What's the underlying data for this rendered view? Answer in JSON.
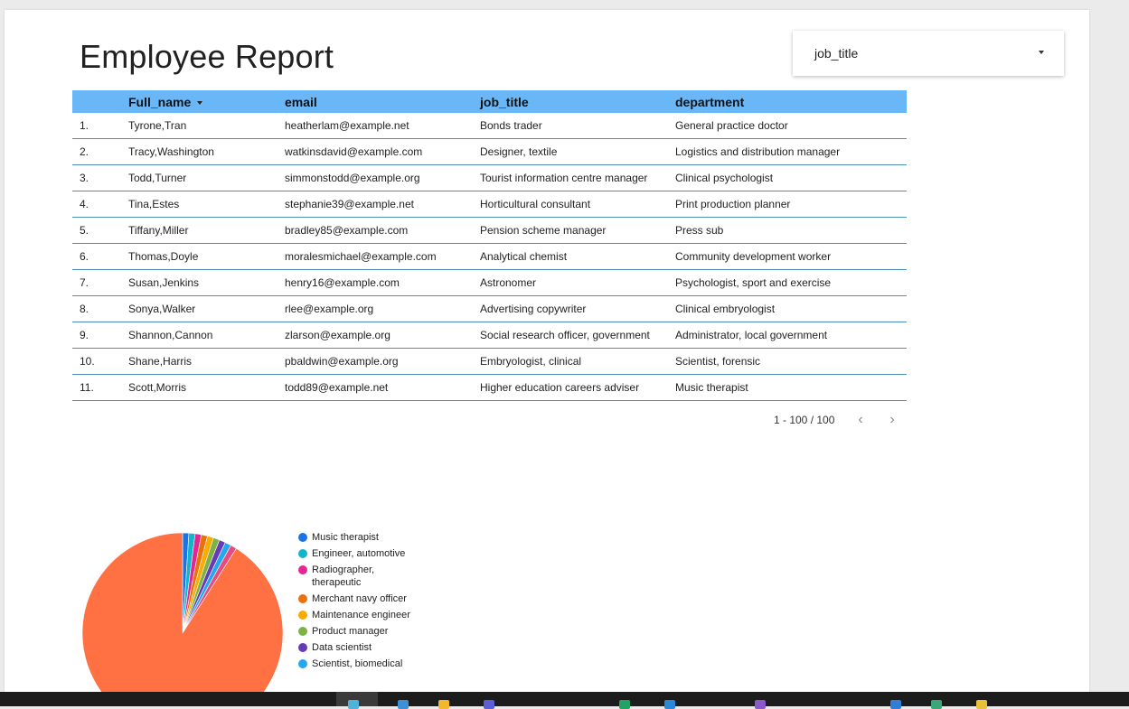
{
  "report": {
    "title": "Employee Report"
  },
  "filter": {
    "label": "job_title"
  },
  "table": {
    "headers": [
      "",
      "Full_name",
      "email",
      "job_title",
      "department"
    ],
    "rows": [
      [
        "1.",
        "Tyrone,Tran",
        "heatherlam@example.net",
        "Bonds trader",
        "General practice doctor"
      ],
      [
        "2.",
        "Tracy,Washington",
        "watkinsdavid@example.com",
        "Designer, textile",
        "Logistics and distribution manager"
      ],
      [
        "3.",
        "Todd,Turner",
        "simmonstodd@example.org",
        "Tourist information centre manager",
        "Clinical psychologist"
      ],
      [
        "4.",
        "Tina,Estes",
        "stephanie39@example.net",
        "Horticultural consultant",
        "Print production planner"
      ],
      [
        "5.",
        "Tiffany,Miller",
        "bradley85@example.com",
        "Pension scheme manager",
        "Press sub"
      ],
      [
        "6.",
        "Thomas,Doyle",
        "moralesmichael@example.com",
        "Analytical chemist",
        "Community development worker"
      ],
      [
        "7.",
        "Susan,Jenkins",
        "henry16@example.com",
        "Astronomer",
        "Psychologist, sport and exercise"
      ],
      [
        "8.",
        "Sonya,Walker",
        "rlee@example.org",
        "Advertising copywriter",
        "Clinical embryologist"
      ],
      [
        "9.",
        "Shannon,Cannon",
        "zlarson@example.org",
        "Social research officer, government",
        "Administrator, local government"
      ],
      [
        "10.",
        "Shane,Harris",
        "pbaldwin@example.org",
        "Embryologist, clinical",
        "Scientist, forensic"
      ],
      [
        "11.",
        "Scott,Morris",
        "todd89@example.net",
        "Higher education careers adviser",
        "Music therapist"
      ]
    ]
  },
  "pagination": {
    "range": "1 - 100 / 100",
    "prev_icon": "chevron-left-icon",
    "next_icon": "chevron-right-icon"
  },
  "chart_data": {
    "type": "pie",
    "slices": [
      {
        "label": "Music therapist",
        "value": 1,
        "color": "#1a73e8"
      },
      {
        "label": "Engineer, automotive",
        "value": 1,
        "color": "#12b5cb"
      },
      {
        "label": "Radiographer, therapeutic",
        "value": 1,
        "color": "#e52592"
      },
      {
        "label": "Merchant navy officer",
        "value": 1,
        "color": "#e8710a"
      },
      {
        "label": "Maintenance engineer",
        "value": 1,
        "color": "#f9ab00"
      },
      {
        "label": "Product manager",
        "value": 1,
        "color": "#7cb342"
      },
      {
        "label": "Data scientist",
        "value": 1,
        "color": "#673ab7"
      },
      {
        "label": "Scientist, biomedical",
        "value": 1,
        "color": "#24a7ec"
      },
      {
        "label": "",
        "value": 1,
        "color": "#e84b7f"
      },
      {
        "label": "",
        "value": 91,
        "color": "#ff7043"
      }
    ]
  },
  "theme": {
    "header_bg": "#6ab7f7",
    "row_border": "#4d8fb9"
  }
}
